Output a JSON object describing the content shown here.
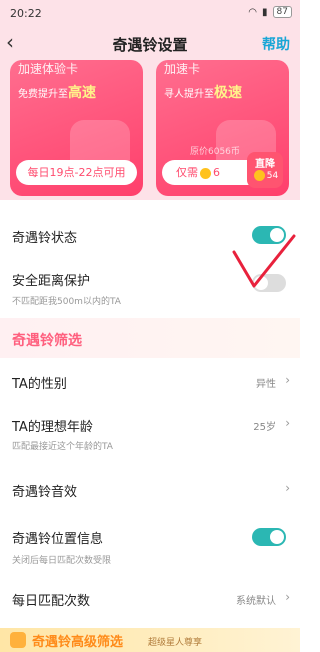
{
  "status_bar": {
    "time": "20:22",
    "battery": "87"
  },
  "header": {
    "title": "奇遇铃设置",
    "help_label": "帮助"
  },
  "cards": {
    "left": {
      "name": "加速体验卡",
      "sub_prefix": "免费提升至",
      "sub_highlight": "高速",
      "pill": "每日19点-22点可用"
    },
    "right": {
      "name": "加速卡",
      "sub_prefix": "寻人提升至",
      "sub_highlight": "极速",
      "original_price": "原价6056币",
      "price_prefix": "仅需",
      "price": "6",
      "badge_label": "直降",
      "badge_value": "54"
    }
  },
  "settings": {
    "status": {
      "label": "奇遇铃状态",
      "enabled": true
    },
    "safety": {
      "label": "安全距离保护",
      "desc": "不匹配距我500m以内的TA",
      "enabled": false
    }
  },
  "filter": {
    "heading": "奇遇铃筛选",
    "gender": {
      "label": "TA的性别",
      "value": "异性"
    },
    "age": {
      "label": "TA的理想年龄",
      "value": "25岁",
      "desc": "匹配最接近这个年龄的TA"
    },
    "sound": {
      "label": "奇遇铃音效"
    },
    "location": {
      "label": "奇遇铃位置信息",
      "desc": "关闭后每日匹配次数受限",
      "enabled": true
    },
    "daily": {
      "label": "每日匹配次数",
      "value": "系统默认"
    }
  },
  "premium": {
    "heading": "奇遇铃高级筛选",
    "sub": "超级星人尊享"
  },
  "colors": {
    "accent": "#ff4b6e",
    "toggle_on": "#2bb7b3",
    "help": "#1aa6d6"
  }
}
